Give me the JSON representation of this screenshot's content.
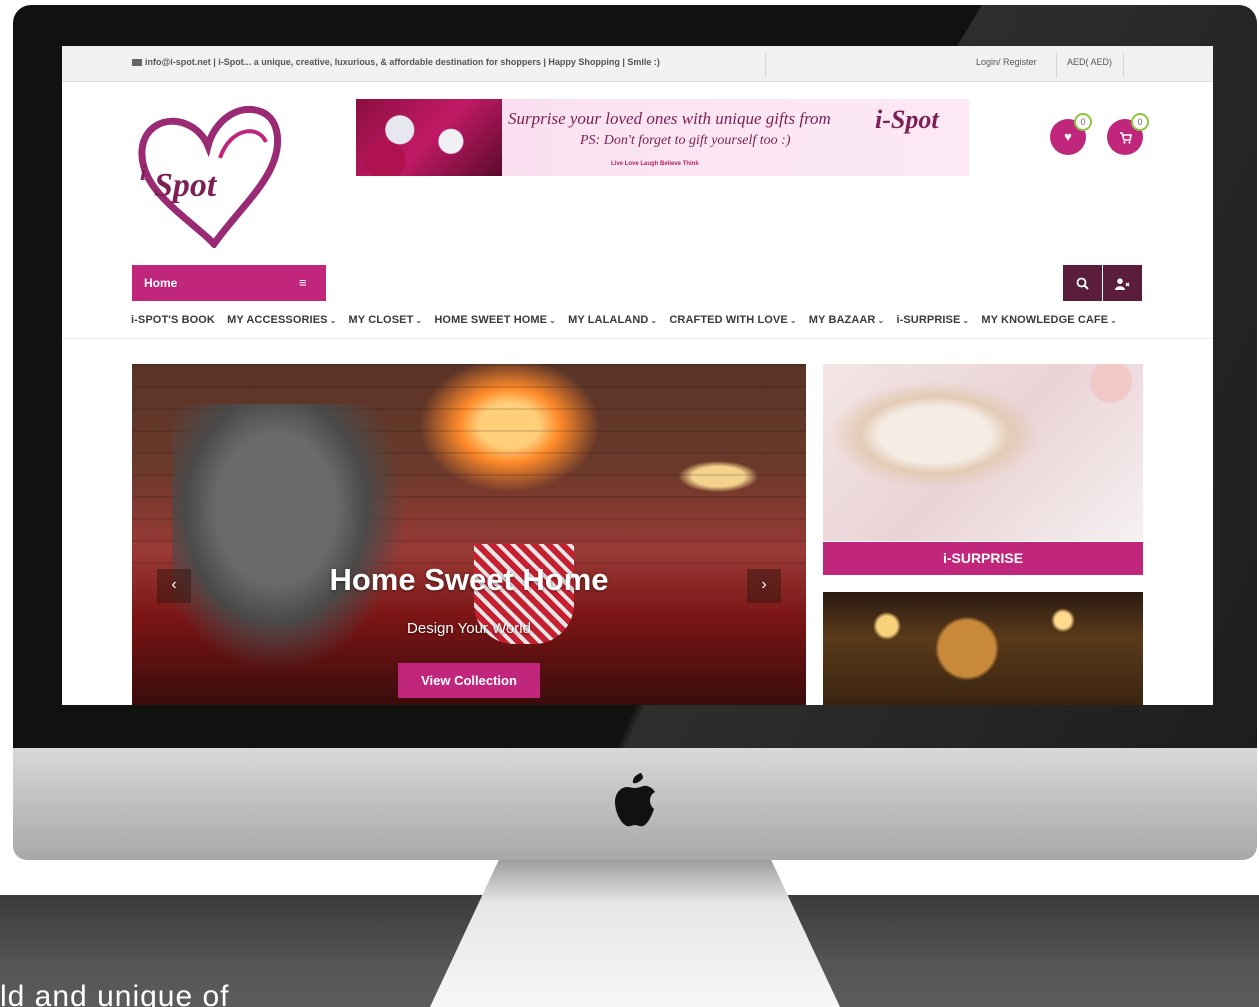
{
  "topbar": {
    "contact": "info@i-spot.net | i-Spot... a unique, creative, luxurious, & affordable destination for shoppers | Happy Shopping | Smile :)",
    "login": "Login/ Register",
    "currency": "AED( AED)"
  },
  "logo": {
    "text": "i-Spot"
  },
  "banner": {
    "line1": "Surprise your loved ones with unique gifts from",
    "brand": "i-Spot",
    "line2": "PS: Don't forget to gift yourself too :)",
    "line3": "Live  Love  Laugh  Believe  Think"
  },
  "wishlist": {
    "count": "0"
  },
  "cart": {
    "count": "0"
  },
  "homebar": {
    "label": "Home"
  },
  "nav": {
    "items": [
      {
        "label": "i-SPOT'S BOOK",
        "chevron": false
      },
      {
        "label": "MY ACCESSORIES",
        "chevron": true
      },
      {
        "label": "MY CLOSET",
        "chevron": true
      },
      {
        "label": "HOME SWEET HOME",
        "chevron": true
      },
      {
        "label": "MY LALALAND",
        "chevron": true
      },
      {
        "label": "CRAFTED WITH LOVE",
        "chevron": true
      },
      {
        "label": "MY BAZAAR",
        "chevron": true
      },
      {
        "label": "i-SURPRISE",
        "chevron": true
      },
      {
        "label": "MY KNOWLEDGE CAFE",
        "chevron": true
      }
    ]
  },
  "slider": {
    "title": "Home Sweet Home",
    "subtitle": "Design Your World",
    "cta": "View Collection",
    "prev_icon": "‹",
    "next_icon": "›"
  },
  "promos": {
    "first_label": "i-SURPRISE"
  },
  "background_caption": "ld and unique of",
  "colors": {
    "brand": "#c0267b",
    "dark_accent": "#5a1e3c",
    "badge_ring": "#8cc63f"
  },
  "icons": {
    "mail": "mail-icon",
    "heart": "heart-icon",
    "cart": "cart-icon",
    "menu": "hamburger-icon",
    "search": "search-icon",
    "user": "user-icon",
    "apple": "apple-logo-icon"
  }
}
